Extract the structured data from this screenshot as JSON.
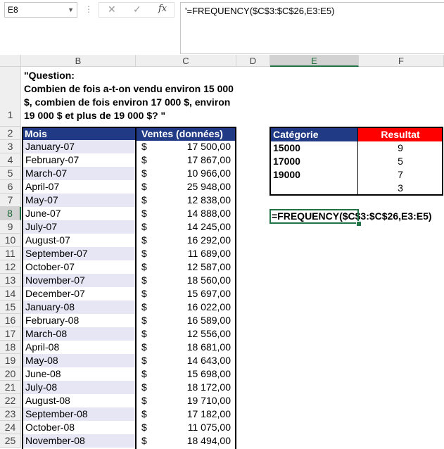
{
  "formula_bar": {
    "name_box": "E8",
    "cancel_icon": "✕",
    "enter_icon": "✓",
    "fx_label": "fx",
    "content": "'=FREQUENCY($C$3:$C$26,E3:E5)"
  },
  "columns": [
    "B",
    "C",
    "D",
    "E",
    "F"
  ],
  "rows": [
    "1",
    "2",
    "3",
    "4",
    "5",
    "6",
    "7",
    "8",
    "9",
    "10",
    "11",
    "12",
    "13",
    "14",
    "15",
    "16",
    "17",
    "18",
    "19",
    "20",
    "21",
    "22",
    "23",
    "24",
    "25"
  ],
  "question": "\"Question:\nCombien de fois a-t-on vendu environ 15 000 $, combien de fois environ 17 000 $, environ 19 000 $ et plus de 19 000 $? \"",
  "sales_table": {
    "header_month": "Mois",
    "header_sales": "Ventes (données)",
    "currency": "$",
    "rows": [
      {
        "mois": "January-07",
        "ventes": "17 500,00"
      },
      {
        "mois": "February-07",
        "ventes": "17 867,00"
      },
      {
        "mois": "March-07",
        "ventes": "10 966,00"
      },
      {
        "mois": "April-07",
        "ventes": "25 948,00"
      },
      {
        "mois": "May-07",
        "ventes": "12 838,00"
      },
      {
        "mois": "June-07",
        "ventes": "14 888,00"
      },
      {
        "mois": "July-07",
        "ventes": "14 245,00"
      },
      {
        "mois": "August-07",
        "ventes": "16 292,00"
      },
      {
        "mois": "September-07",
        "ventes": "11 689,00"
      },
      {
        "mois": "October-07",
        "ventes": "12 587,00"
      },
      {
        "mois": "November-07",
        "ventes": "18 560,00"
      },
      {
        "mois": "December-07",
        "ventes": "15 697,00"
      },
      {
        "mois": "January-08",
        "ventes": "16 022,00"
      },
      {
        "mois": "February-08",
        "ventes": "16 589,00"
      },
      {
        "mois": "March-08",
        "ventes": "12 556,00"
      },
      {
        "mois": "April-08",
        "ventes": "18 681,00"
      },
      {
        "mois": "May-08",
        "ventes": "14 643,00"
      },
      {
        "mois": "June-08",
        "ventes": "15 698,00"
      },
      {
        "mois": "July-08",
        "ventes": "18 172,00"
      },
      {
        "mois": "August-08",
        "ventes": "19 710,00"
      },
      {
        "mois": "September-08",
        "ventes": "17 182,00"
      },
      {
        "mois": "October-08",
        "ventes": "11 075,00"
      },
      {
        "mois": "November-08",
        "ventes": "18 494,00"
      }
    ]
  },
  "category_table": {
    "header_category": "Catégorie",
    "header_result": "Resultat",
    "rows": [
      {
        "cat": "15000",
        "res": "9"
      },
      {
        "cat": "17000",
        "res": "5"
      },
      {
        "cat": "19000",
        "res": "7"
      },
      {
        "cat": "",
        "res": "3"
      }
    ]
  },
  "active_cell_formula": "=FREQUENCY($C$3:$C$26,E3:E5)",
  "colors": {
    "header_blue": "#203a85",
    "result_red": "#ff0000",
    "row_stripe": "#e6e6f5",
    "excel_green": "#217346"
  }
}
